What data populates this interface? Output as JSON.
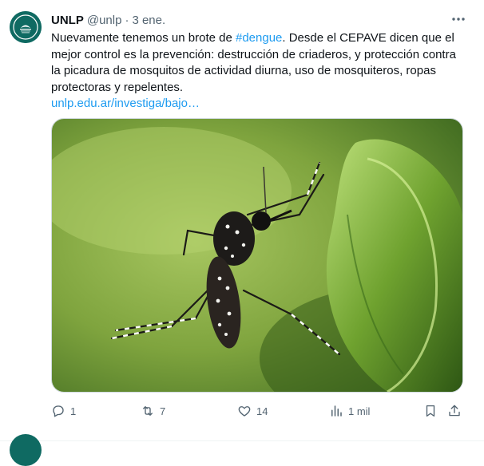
{
  "tweet": {
    "author_name": "UNLP",
    "handle": "@unlp",
    "separator": "·",
    "time": "3 ene.",
    "text_before_hashtag": "Nuevamente tenemos un brote de ",
    "hashtag": "#dengue",
    "text_after_hashtag": ". Desde el CEPAVE dicen que el mejor control es la prevención: destrucción de criaderos, y protección contra la picadura de mosquitos de actividad diurna, uso de mosquiteros, ropas protectoras y repelentes.",
    "link": "unlp.edu.ar/investiga/bajo…",
    "avatar_text": "UNIVERSIDAD NACIONAL DE LA PLATA"
  },
  "actions": {
    "replies": "1",
    "reposts": "7",
    "likes": "14",
    "views": "1 mil"
  },
  "icons": {
    "more": "more-horizontal-icon",
    "reply": "reply-icon",
    "repost": "repost-icon",
    "like": "heart-icon",
    "views": "views-chart-icon",
    "bookmark": "bookmark-icon",
    "share": "share-icon"
  },
  "colors": {
    "link": "#1d9bf0",
    "secondary_text": "#536471",
    "avatar_bg": "#0f6a62"
  }
}
